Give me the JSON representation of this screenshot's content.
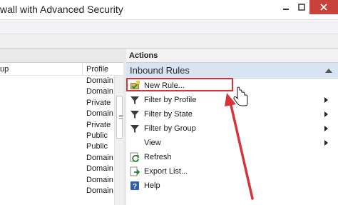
{
  "window": {
    "title": "wall with Advanced Security",
    "minimize_label": "minimize",
    "restore_label": "restore",
    "close_label": "close"
  },
  "left_pane": {
    "columns": {
      "group": "up",
      "profile": "Profile"
    },
    "profiles": [
      "Domain",
      "Domain",
      "Private",
      "Domain",
      "Private",
      "Public",
      "Public",
      "Domain",
      "Domain",
      "Domain",
      "Domain"
    ]
  },
  "actions": {
    "header": "Actions",
    "section_title": "Inbound Rules",
    "items": [
      {
        "label": "New Rule...",
        "icon": "new-rule-icon",
        "submenu": false
      },
      {
        "label": "Filter by Profile",
        "icon": "filter-icon",
        "submenu": true
      },
      {
        "label": "Filter by State",
        "icon": "filter-icon",
        "submenu": true
      },
      {
        "label": "Filter by Group",
        "icon": "filter-icon",
        "submenu": true
      },
      {
        "label": "View",
        "icon": "",
        "submenu": true
      },
      {
        "label": "Refresh",
        "icon": "refresh-icon",
        "submenu": false
      },
      {
        "label": "Export List...",
        "icon": "export-list-icon",
        "submenu": false
      },
      {
        "label": "Help",
        "icon": "help-icon",
        "submenu": false
      }
    ]
  },
  "colors": {
    "section_bg": "#d9e4f2",
    "highlight": "#d6333a",
    "close_button": "#c8413a"
  }
}
